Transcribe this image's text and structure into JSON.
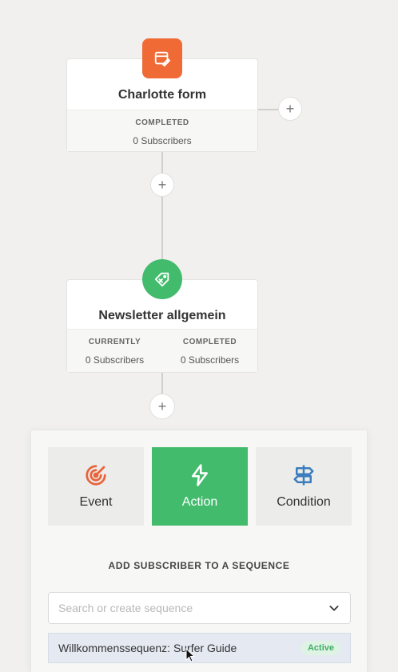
{
  "form_node": {
    "title": "Charlotte form",
    "status_label": "COMPLETED",
    "subscribers": "0 Subscribers",
    "icon": "form-edit-icon"
  },
  "tag_node": {
    "title": "Newsletter allgemein",
    "currently_label": "CURRENTLY",
    "currently_value": "0 Subscribers",
    "completed_label": "COMPLETED",
    "completed_value": "0 Subscribers",
    "icon": "tag-add-icon"
  },
  "add_step": {
    "tiles": [
      {
        "label": "Event",
        "icon": "target-icon"
      },
      {
        "label": "Action",
        "icon": "lightning-icon"
      },
      {
        "label": "Condition",
        "icon": "signpost-icon"
      }
    ],
    "heading": "ADD SUBSCRIBER TO A SEQUENCE",
    "search_placeholder": "Search or create sequence",
    "options": [
      {
        "label": "Willkommenssequenz: Surfer Guide",
        "badge": "Active"
      }
    ]
  },
  "colors": {
    "form_accent": "#f06a35",
    "green_accent": "#43bb6d",
    "event_icon": "#e8643c",
    "condition_icon": "#3b7dbd",
    "option_highlight": "#e4e9f2"
  }
}
